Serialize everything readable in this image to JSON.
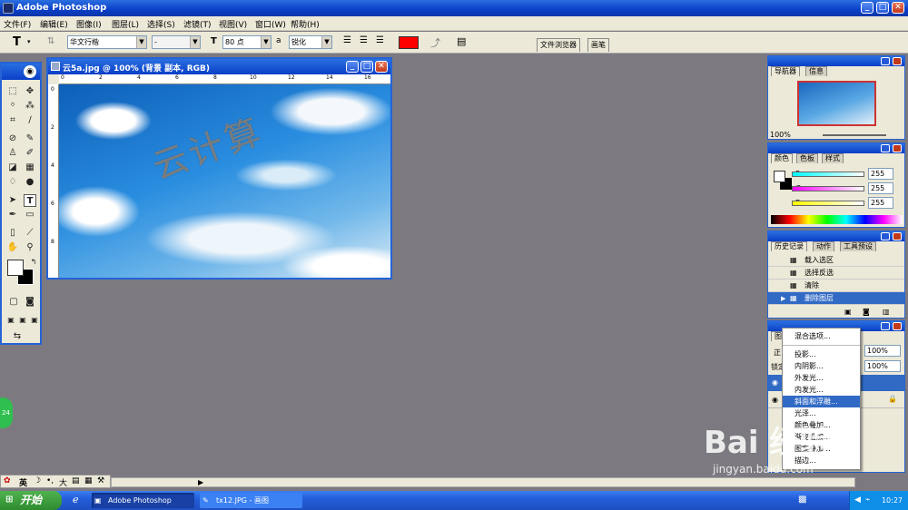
{
  "window": {
    "title": "Adobe Photoshop"
  },
  "menu": [
    "文件(F)",
    "编辑(E)",
    "图像(I)",
    "图层(L)",
    "选择(S)",
    "滤镜(T)",
    "视图(V)",
    "窗口(W)",
    "帮助(H)"
  ],
  "options": {
    "font_family": "华文行楷",
    "font_style": "-",
    "font_size": "80 点",
    "aa_label": "a",
    "antialias": "锐化",
    "text_color": "#ff0000",
    "tab_file_browser": "文件浏览器",
    "tab_brushes": "画笔"
  },
  "document": {
    "title": "云5a.jpg @ 100% (背景 副本, RGB)",
    "ruler_h": [
      "0",
      "2",
      "4",
      "6",
      "8",
      "10",
      "12",
      "14",
      "16"
    ],
    "ruler_v": [
      "0",
      "2",
      "4",
      "6",
      "8"
    ],
    "ghost_text": "云计算"
  },
  "navigator": {
    "tabs": [
      "导航器",
      "信息"
    ],
    "zoom": "100%"
  },
  "color_panel": {
    "tabs": [
      "颜色",
      "色板",
      "样式"
    ],
    "channels": [
      {
        "label": "R",
        "value": "255"
      },
      {
        "label": "G",
        "value": "255"
      },
      {
        "label": "B",
        "value": "255"
      }
    ]
  },
  "history": {
    "tabs": [
      "历史记录",
      "动作",
      "工具预设"
    ],
    "items": [
      "载入选区",
      "选择反选",
      "清除",
      "删除图层"
    ]
  },
  "layers": {
    "tab_partial": "图",
    "mode_partial": "正",
    "lock_partial": "锁定",
    "opacity": "100%",
    "fill": "100%"
  },
  "context_menu": [
    "混合选项...",
    "投影...",
    "内阴影...",
    "外发光...",
    "内发光...",
    "斜面和浮雕...",
    "光泽...",
    "颜色叠加...",
    "渐变叠加...",
    "图案叠加...",
    "描边..."
  ],
  "context_selected": "斜面和浮雕...",
  "ime": {
    "label": "英",
    "extra": "大"
  },
  "badge": "24",
  "taskbar": {
    "start": "开始",
    "tasks": [
      "Adobe Photoshop",
      "tx12.JPG - 画图"
    ],
    "time": "10:27"
  },
  "watermark": {
    "brand": "Bai 经验",
    "url": "jingyan.baidu.com"
  }
}
